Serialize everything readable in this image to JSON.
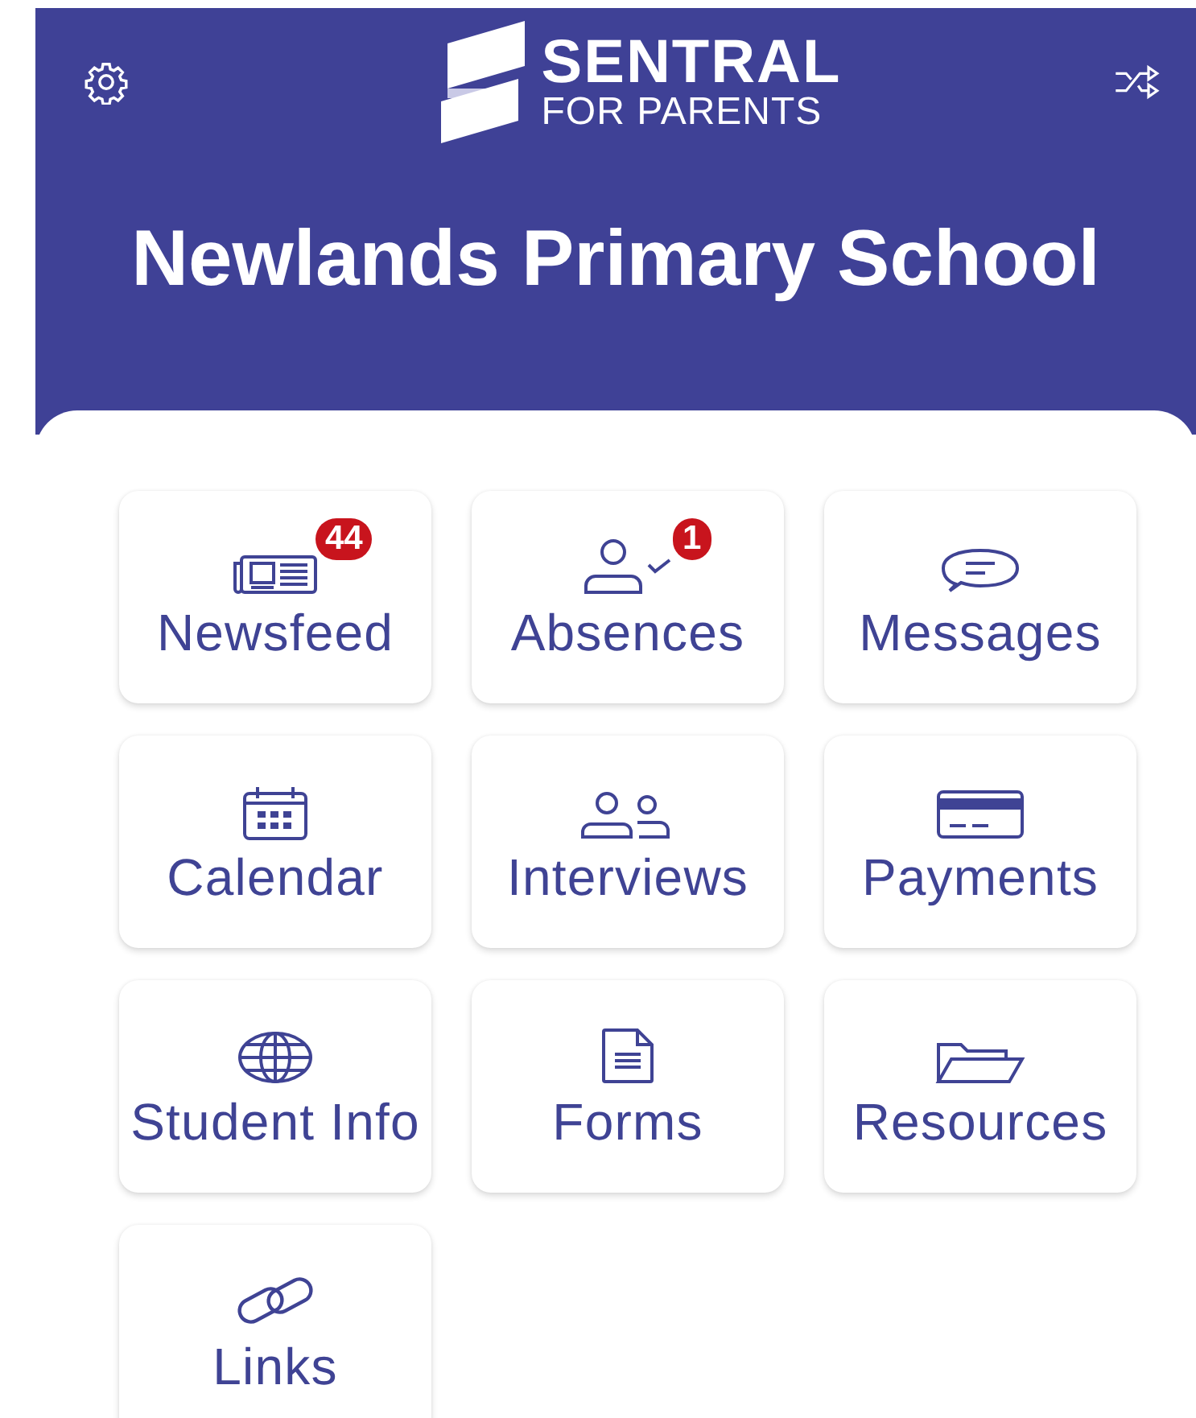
{
  "header": {
    "logo": {
      "name": "SENTRAL",
      "subtitle": "FOR PARENTS"
    },
    "school": "Newlands Primary School"
  },
  "tiles": [
    {
      "label": "Newsfeed",
      "kind": "newspaper",
      "badge": "44"
    },
    {
      "label": "Absences",
      "kind": "absence",
      "badge": "1"
    },
    {
      "label": "Messages",
      "kind": "chat"
    },
    {
      "label": "Calendar",
      "kind": "calendar"
    },
    {
      "label": "Interviews",
      "kind": "people"
    },
    {
      "label": "Payments",
      "kind": "card"
    },
    {
      "label": "Student Info",
      "kind": "globe"
    },
    {
      "label": "Forms",
      "kind": "document"
    },
    {
      "label": "Resources",
      "kind": "folder"
    },
    {
      "label": "Links",
      "kind": "link"
    }
  ]
}
